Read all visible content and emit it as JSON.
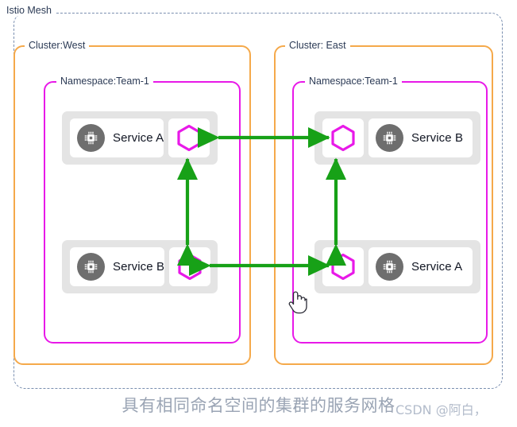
{
  "mesh": {
    "title": "Istio Mesh",
    "border_color": "#7a8fb0"
  },
  "clusters": [
    {
      "id": "west",
      "label": "Cluster:West",
      "border_color": "#f5a94a",
      "namespace": {
        "label": "Namespace:Team-1",
        "border_color": "#e819e8"
      },
      "pods": [
        {
          "id": "west-top",
          "service_label": "Service A",
          "service_icon": "chip-icon",
          "proxy_icon": "hexagon-icon",
          "order": "service-first"
        },
        {
          "id": "west-bottom",
          "service_label": "Service B",
          "service_icon": "chip-icon",
          "proxy_icon": "hexagon-icon",
          "order": "service-first"
        }
      ]
    },
    {
      "id": "east",
      "label": "Cluster: East",
      "border_color": "#f5a94a",
      "namespace": {
        "label": "Namespace:Team-1",
        "border_color": "#e819e8"
      },
      "pods": [
        {
          "id": "east-top",
          "service_label": "Service B",
          "service_icon": "chip-icon",
          "proxy_icon": "hexagon-icon",
          "order": "proxy-first"
        },
        {
          "id": "east-bottom",
          "service_label": "Service A",
          "service_icon": "chip-icon",
          "proxy_icon": "hexagon-icon",
          "order": "proxy-first"
        }
      ]
    }
  ],
  "connections": [
    {
      "id": "top-cross-cluster",
      "from": "west-top-proxy",
      "to": "east-top-proxy",
      "direction": "bidirectional",
      "color": "#17a117",
      "orientation": "horizontal"
    },
    {
      "id": "bottom-cross-cluster",
      "from": "west-bottom-proxy",
      "to": "east-bottom-proxy",
      "direction": "bidirectional",
      "color": "#17a117",
      "orientation": "horizontal"
    },
    {
      "id": "west-internal",
      "from": "west-top-proxy",
      "to": "west-bottom-proxy",
      "direction": "bidirectional",
      "color": "#17a117",
      "orientation": "vertical"
    },
    {
      "id": "east-internal",
      "from": "east-top-proxy",
      "to": "east-bottom-proxy",
      "direction": "bidirectional",
      "color": "#17a117",
      "orientation": "vertical"
    }
  ],
  "cursor": {
    "type": "pointing-hand"
  },
  "caption": "具有相同命名空间的集群的服务网格",
  "watermark": "CSDN @阿白，",
  "colors": {
    "mesh_border": "#7a8fb0",
    "cluster_border": "#f5a94a",
    "namespace_border": "#e819e8",
    "proxy_hex": "#e819e8",
    "arrow": "#17a117",
    "pod_bg": "#e4e4e4",
    "chip_bg": "#6e6e6e",
    "label_text": "#2b3a55",
    "caption_text": "#9aa4b4"
  }
}
